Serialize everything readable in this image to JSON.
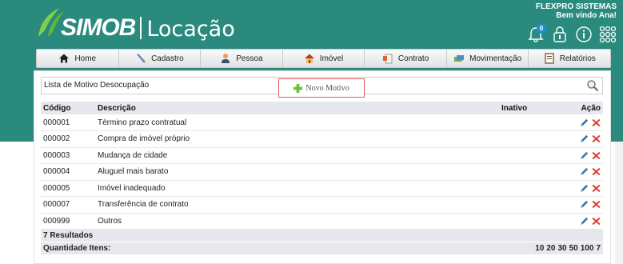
{
  "header": {
    "brand": "SIMOB",
    "module": "Locação",
    "company": "FLEXPRO SISTEMAS",
    "welcome": "Bem vindo Ana!",
    "notification_count": "0"
  },
  "nav": {
    "items": [
      {
        "label": "Home",
        "icon": "home-icon"
      },
      {
        "label": "Cadastro",
        "icon": "pencil-icon"
      },
      {
        "label": "Pessoa",
        "icon": "person-icon"
      },
      {
        "label": "Imóvel",
        "icon": "house-icon"
      },
      {
        "label": "Contrato",
        "icon": "contract-icon"
      },
      {
        "label": "Movimentação",
        "icon": "money-icon"
      },
      {
        "label": "Relatórios",
        "icon": "report-icon"
      }
    ]
  },
  "page": {
    "title": "Lista de Motivo Desocupação",
    "new_button": "Novo Motivo"
  },
  "table": {
    "headers": [
      "Código",
      "Descrição",
      "Inativo",
      "Ação"
    ],
    "rows": [
      {
        "code": "000001",
        "desc": "Término prazo contratual"
      },
      {
        "code": "000002",
        "desc": "Compra de imóvel próprio"
      },
      {
        "code": "000003",
        "desc": "Mudança de cidade"
      },
      {
        "code": "000004",
        "desc": "Aluguel mais barato"
      },
      {
        "code": "000005",
        "desc": "Imóvel inadequado"
      },
      {
        "code": "000007",
        "desc": "Transferência de contrato"
      },
      {
        "code": "000999",
        "desc": "Outros"
      }
    ],
    "results": "7 Resultados",
    "qty_label": "Quantidade Itens:",
    "page_sizes": [
      "10",
      "20",
      "30",
      "50",
      "100",
      "7"
    ]
  },
  "colors": {
    "header_bg": "#2a8a7e",
    "edit_icon": "#3a6fb5",
    "delete_icon": "#d83a2a",
    "new_border": "#e05757"
  }
}
